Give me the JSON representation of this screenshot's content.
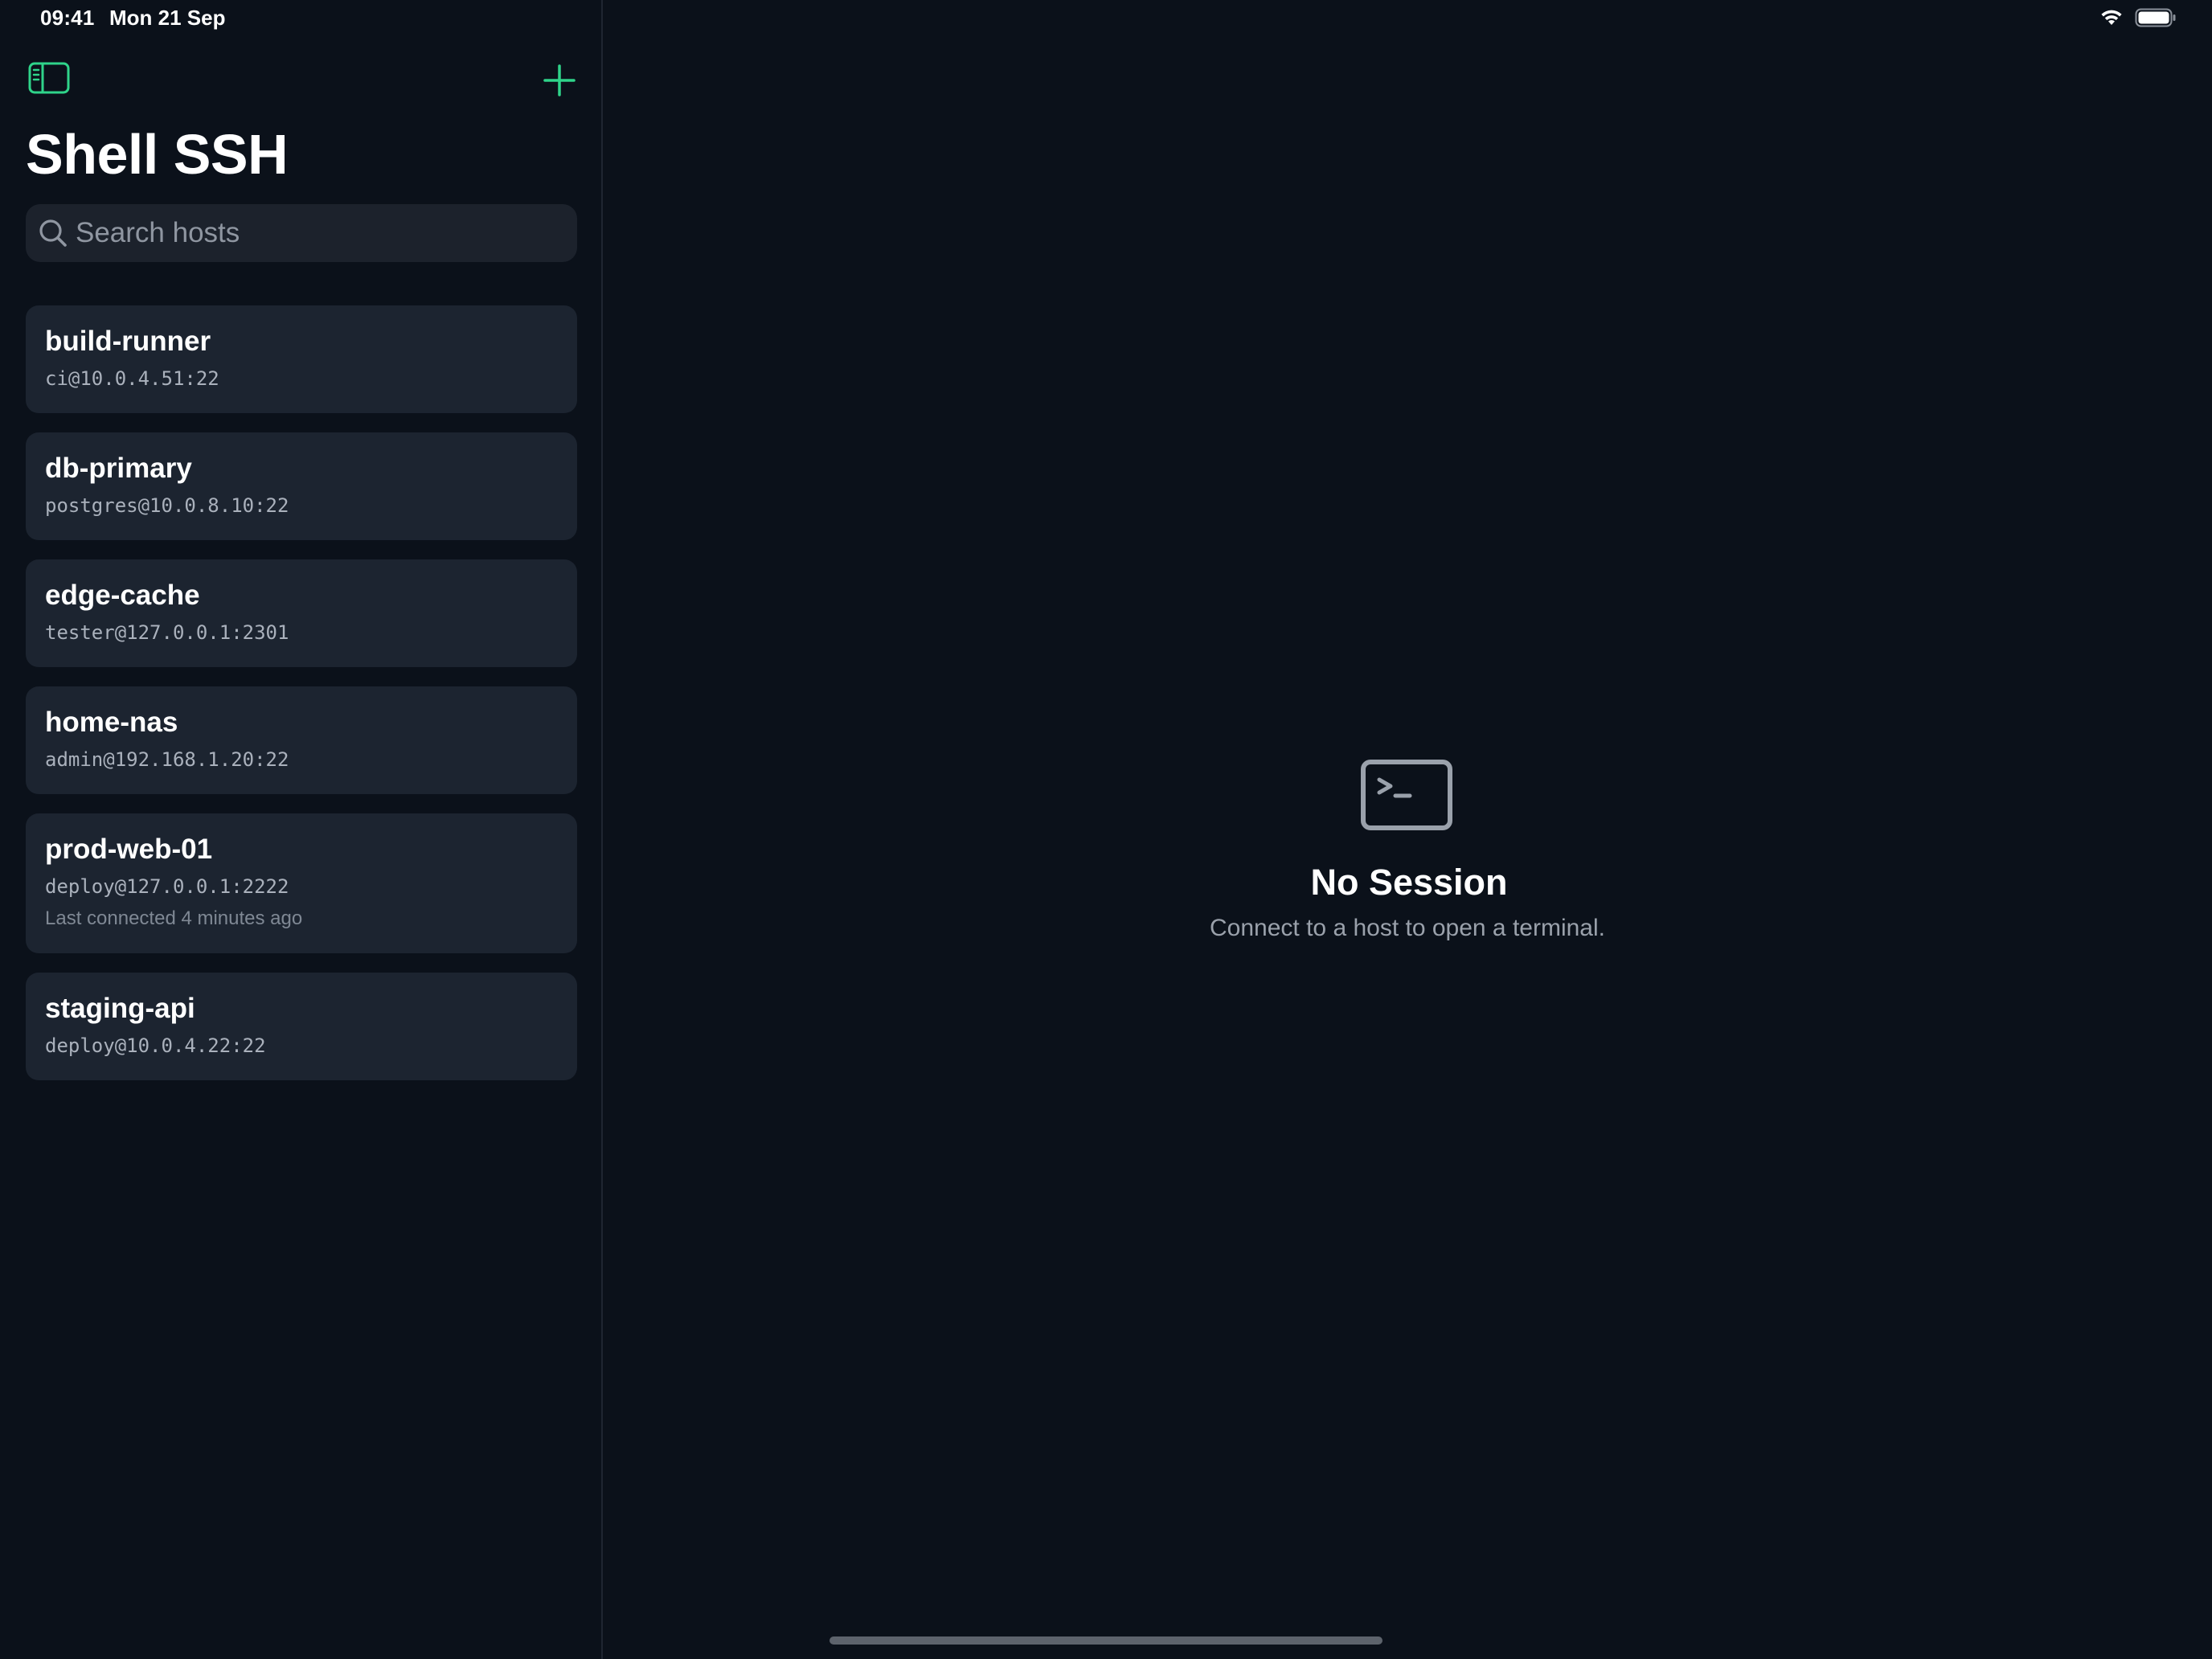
{
  "status_bar": {
    "time": "09:41",
    "date": "Mon 21 Sep"
  },
  "colors": {
    "accent": "#2fd48a",
    "background": "#0b111a",
    "card": "#1c2430",
    "search_field": "#1c222c"
  },
  "sidebar": {
    "title": "Shell SSH",
    "toggle_icon": "sidebar-icon",
    "add_icon": "plus-icon",
    "search": {
      "placeholder": "Search hosts",
      "value": "",
      "icon": "magnifying-glass-icon"
    },
    "hosts": [
      {
        "name": "build-runner",
        "address": "ci@10.0.4.51:22",
        "meta": ""
      },
      {
        "name": "db-primary",
        "address": "postgres@10.0.8.10:22",
        "meta": ""
      },
      {
        "name": "edge-cache",
        "address": "tester@127.0.0.1:2301",
        "meta": ""
      },
      {
        "name": "home-nas",
        "address": "admin@192.168.1.20:22",
        "meta": ""
      },
      {
        "name": "prod-web-01",
        "address": "deploy@127.0.0.1:2222",
        "meta": "Last connected 4 minutes ago"
      },
      {
        "name": "staging-api",
        "address": "deploy@10.0.4.22:22",
        "meta": ""
      }
    ]
  },
  "detail": {
    "empty_icon": "terminal-icon",
    "empty_title": "No Session",
    "empty_subtitle": "Connect to a host to open a terminal."
  }
}
